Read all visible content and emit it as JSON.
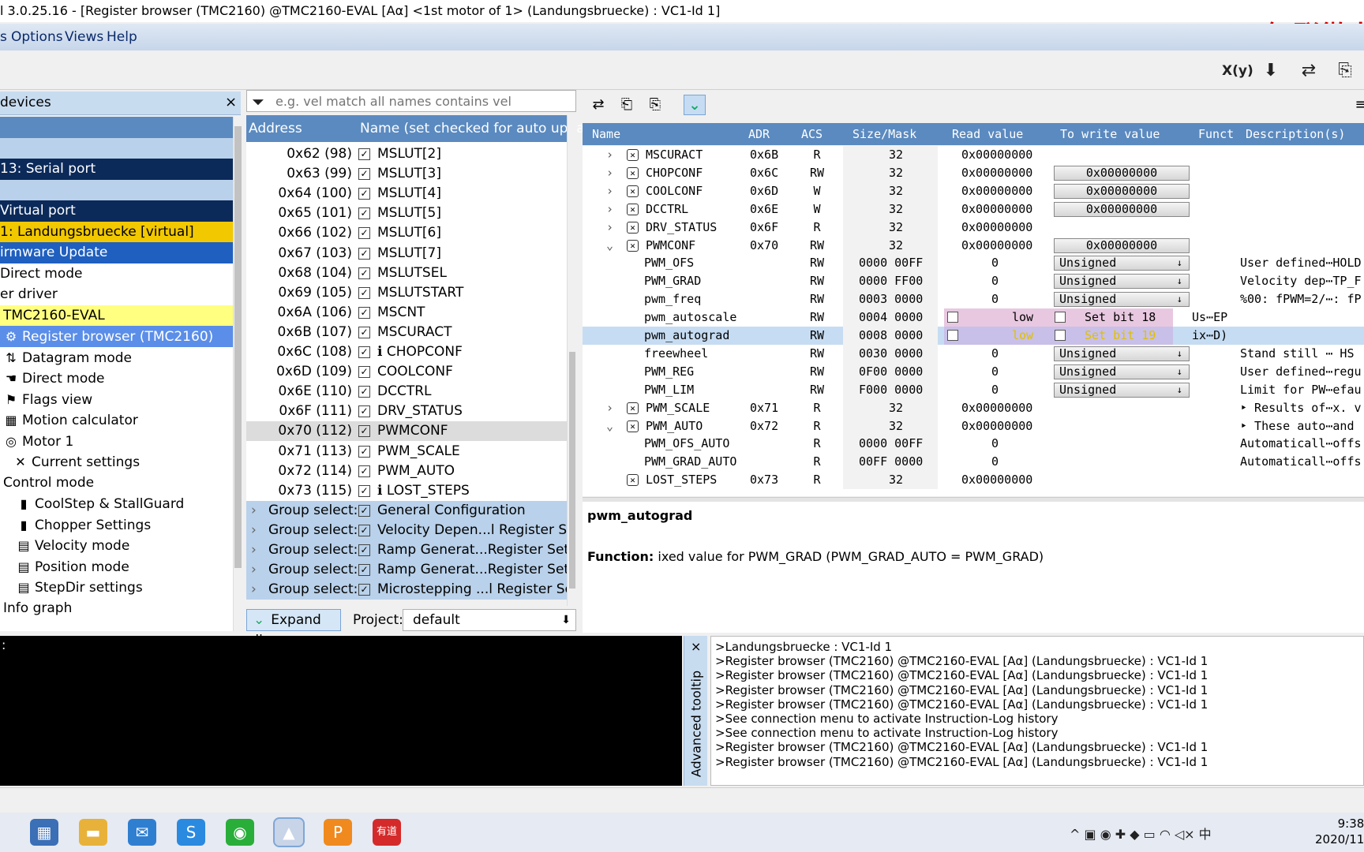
{
  "window": {
    "title": "l 3.0.25.16 - [Register browser (TMC2160) @TMC2160-EVAL [Aα] <1st motor of 1> (Landungsbruecke) : VC1-Id 1]",
    "brand_overlay": "智联微电"
  },
  "menu": {
    "items": [
      "s",
      "Options",
      "Views",
      "Help"
    ]
  },
  "toolbar": {
    "icons": [
      "x-y-icon",
      "download-icon",
      "swap-icon",
      "export-icon"
    ],
    "xy_label": "X(y)"
  },
  "left_panel": {
    "title": "devices",
    "close": "×",
    "tree": [
      {
        "label": "",
        "bg": "#5b8ac0",
        "color": "#fff",
        "icon": ""
      },
      {
        "label": "",
        "bg": "#b9d1ea",
        "color": "#000",
        "icon": ""
      },
      {
        "label": "13: Serial port",
        "bg": "#0b2a5a",
        "color": "#fff",
        "icon": ""
      },
      {
        "label": "",
        "bg": "#b9d1ea",
        "color": "#000",
        "icon": ""
      },
      {
        "label": " Virtual port",
        "bg": "#0b2a5a",
        "color": "#fff",
        "icon": ""
      },
      {
        "label": "1: Landungsbruecke [virtual]",
        "bg": "#f2c800",
        "color": "#000",
        "icon": ""
      },
      {
        "label": "irmware Update",
        "bg": "#1f5fbf",
        "color": "#fff",
        "icon": ""
      },
      {
        "label": "Direct mode",
        "bg": "#fff",
        "color": "#000",
        "icon": ""
      },
      {
        "label": "er driver",
        "bg": "#fff",
        "color": "#000",
        "icon": ""
      },
      {
        "label": "TMC2160-EVAL",
        "bg": "#ffff80",
        "color": "#000",
        "icon": ""
      },
      {
        "label": "Register browser (TMC2160)",
        "bg": "#5b8ee8",
        "color": "#fff",
        "icon": "⚙"
      },
      {
        "label": "Datagram mode",
        "bg": "#fff",
        "color": "#000",
        "icon": "⇅"
      },
      {
        "label": "Direct mode",
        "bg": "#fff",
        "color": "#000",
        "icon": "☚"
      },
      {
        "label": "Flags view",
        "bg": "#fff",
        "color": "#000",
        "icon": "⚑"
      },
      {
        "label": "Motion calculator",
        "bg": "#fff",
        "color": "#000",
        "icon": "▦"
      },
      {
        "label": "Motor 1",
        "bg": "#fff",
        "color": "#000",
        "icon": "◎"
      },
      {
        "label": "Current settings",
        "bg": "#fff",
        "color": "#000",
        "icon": "✕"
      },
      {
        "label": "Control mode",
        "bg": "#fff",
        "color": "#000",
        "icon": ""
      },
      {
        "label": "CoolStep & StallGuard",
        "bg": "#fff",
        "color": "#000",
        "icon": "▮"
      },
      {
        "label": "Chopper Settings",
        "bg": "#fff",
        "color": "#000",
        "icon": "▮"
      },
      {
        "label": "Velocity mode",
        "bg": "#fff",
        "color": "#000",
        "icon": "▤"
      },
      {
        "label": "Position mode",
        "bg": "#fff",
        "color": "#000",
        "icon": "▤"
      },
      {
        "label": "StepDir settings",
        "bg": "#fff",
        "color": "#000",
        "icon": "▤"
      },
      {
        "label": "Info graph",
        "bg": "#fff",
        "color": "#000",
        "icon": ""
      }
    ]
  },
  "middle_panel": {
    "filter_placeholder": "e.g. vel match all names contains vel",
    "col_address": "Address",
    "col_name": "Name (set checked for auto upda",
    "rows": [
      {
        "addr": "0x62 (98)",
        "name": "MSLUT[2]",
        "info": false
      },
      {
        "addr": "0x63 (99)",
        "name": "MSLUT[3]",
        "info": false
      },
      {
        "addr": "0x64 (100)",
        "name": "MSLUT[4]",
        "info": false
      },
      {
        "addr": "0x65 (101)",
        "name": "MSLUT[5]",
        "info": false
      },
      {
        "addr": "0x66 (102)",
        "name": "MSLUT[6]",
        "info": false
      },
      {
        "addr": "0x67 (103)",
        "name": "MSLUT[7]",
        "info": false
      },
      {
        "addr": "0x68 (104)",
        "name": "MSLUTSEL",
        "info": false
      },
      {
        "addr": "0x69 (105)",
        "name": "MSLUTSTART",
        "info": false
      },
      {
        "addr": "0x6A (106)",
        "name": "MSCNT",
        "info": false
      },
      {
        "addr": "0x6B (107)",
        "name": "MSCURACT",
        "info": false
      },
      {
        "addr": "0x6C (108)",
        "name": "CHOPCONF",
        "info": true
      },
      {
        "addr": "0x6D (109)",
        "name": "COOLCONF",
        "info": false
      },
      {
        "addr": "0x6E (110)",
        "name": "DCCTRL",
        "info": false
      },
      {
        "addr": "0x6F (111)",
        "name": "DRV_STATUS",
        "info": false
      },
      {
        "addr": "0x70 (112)",
        "name": "PWMCONF",
        "info": false,
        "selected": true
      },
      {
        "addr": "0x71 (113)",
        "name": "PWM_SCALE",
        "info": false
      },
      {
        "addr": "0x72 (114)",
        "name": "PWM_AUTO",
        "info": false
      },
      {
        "addr": "0x73 (115)",
        "name": "LOST_STEPS",
        "info": true
      }
    ],
    "groups": [
      {
        "label": "Group select:",
        "name": "General Configuration"
      },
      {
        "label": "Group select:",
        "name": "Velocity Depen...l Register Set"
      },
      {
        "label": "Group select:",
        "name": "Ramp Generat...Register Set"
      },
      {
        "label": "Group select:",
        "name": "Ramp Generat...Register Set"
      },
      {
        "label": "Group select:",
        "name": "Microstepping ...l Register Set"
      }
    ],
    "expand_all": "Expand all",
    "project_label": "Project:",
    "project_value": "default"
  },
  "register_table": {
    "headers": [
      "Name",
      "ADR",
      "ACS",
      "Size/Mask",
      "Read value",
      "To write value",
      "Funct",
      "Description(s)"
    ],
    "rows": [
      {
        "type": "reg",
        "exp": "›",
        "name": "MSCURACT",
        "adr": "0x6B",
        "acs": "R",
        "size": "32",
        "read": "0x00000000",
        "write": "",
        "func": "",
        "desc": ""
      },
      {
        "type": "reg",
        "exp": "›",
        "name": "CHOPCONF",
        "adr": "0x6C",
        "acs": "RW",
        "size": "32",
        "read": "0x00000000",
        "write": "0x00000000",
        "func": "",
        "desc": ""
      },
      {
        "type": "reg",
        "exp": "›",
        "name": "COOLCONF",
        "adr": "0x6D",
        "acs": "W",
        "size": "32",
        "read": "0x00000000",
        "write": "0x00000000",
        "func": "",
        "desc": ""
      },
      {
        "type": "reg",
        "exp": "›",
        "name": "DCCTRL",
        "adr": "0x6E",
        "acs": "W",
        "size": "32",
        "read": "0x00000000",
        "write": "0x00000000",
        "func": "",
        "desc": ""
      },
      {
        "type": "reg",
        "exp": "›",
        "name": "DRV_STATUS",
        "adr": "0x6F",
        "acs": "R",
        "size": "32",
        "read": "0x00000000",
        "write": "",
        "func": "",
        "desc": ""
      },
      {
        "type": "reg",
        "exp": "⌄",
        "name": "PWMCONF",
        "adr": "0x70",
        "acs": "RW",
        "size": "32",
        "read": "0x00000000",
        "write": "0x00000000",
        "func": "",
        "desc": ""
      },
      {
        "type": "field",
        "name": "PWM_OFS",
        "acs": "RW",
        "size": "0000 00FF",
        "read": "0",
        "dd": "Unsigned",
        "func": "",
        "desc": "User defined⋯HOLD"
      },
      {
        "type": "field",
        "name": "PWM_GRAD",
        "acs": "RW",
        "size": "0000 FF00",
        "read": "0",
        "dd": "Unsigned",
        "func": "",
        "desc": "Velocity dep⋯TP_F"
      },
      {
        "type": "field",
        "name": "pwm_freq",
        "acs": "RW",
        "size": "0003 0000",
        "read": "0",
        "dd": "Unsigned",
        "func": "",
        "desc": "%00: fPWM=2/⋯: fP"
      },
      {
        "type": "bit",
        "name": "pwm_autoscale",
        "acs": "RW",
        "size": "0004 0000",
        "read": "low",
        "bit": "Set bit 18",
        "func": "Us⋯EP",
        "desc": ""
      },
      {
        "type": "bit",
        "name": "pwm_autograd",
        "acs": "RW",
        "size": "0008 0000",
        "read": "low",
        "bit": "Set bit 19",
        "func": "ix⋯D)",
        "desc": "",
        "highlight": true
      },
      {
        "type": "field",
        "name": "freewheel",
        "acs": "RW",
        "size": "0030 0000",
        "read": "0",
        "dd": "Unsigned",
        "func": "",
        "desc": "Stand still ⋯ HS"
      },
      {
        "type": "field",
        "name": "PWM_REG",
        "acs": "RW",
        "size": "0F00 0000",
        "read": "0",
        "dd": "Unsigned",
        "func": "",
        "desc": "User defined⋯regu"
      },
      {
        "type": "field",
        "name": "PWM_LIM",
        "acs": "RW",
        "size": "F000 0000",
        "read": "0",
        "dd": "Unsigned",
        "func": "",
        "desc": "Limit for PW⋯efau"
      },
      {
        "type": "reg",
        "exp": "›",
        "name": "PWM_SCALE",
        "adr": "0x71",
        "acs": "R",
        "size": "32",
        "read": "0x00000000",
        "write": "",
        "func": "",
        "desc": "‣ Results of⋯x. v"
      },
      {
        "type": "reg",
        "exp": "⌄",
        "name": "PWM_AUTO",
        "adr": "0x72",
        "acs": "R",
        "size": "32",
        "read": "0x00000000",
        "write": "",
        "func": "",
        "desc": "‣ These auto⋯and"
      },
      {
        "type": "field2",
        "name": "PWM_OFS_AUTO",
        "acs": "R",
        "size": "0000 00FF",
        "read": "0",
        "func": "",
        "desc": "Automaticall⋯offs"
      },
      {
        "type": "field2",
        "name": "PWM_GRAD_AUTO",
        "acs": "R",
        "size": "00FF 0000",
        "read": "0",
        "func": "",
        "desc": "Automaticall⋯offs"
      },
      {
        "type": "reg",
        "exp": "",
        "name": "LOST_STEPS",
        "adr": "0x73",
        "acs": "R",
        "size": "32",
        "read": "0x00000000",
        "write": "",
        "func": "",
        "desc": ""
      }
    ]
  },
  "detail": {
    "title": "pwm_autograd",
    "function_label": "Function:",
    "function_text": " ixed value for PWM_GRAD (PWM_GRAD_AUTO = PWM_GRAD)"
  },
  "console": {
    "prompt": ":"
  },
  "advanced_tooltip": {
    "label": "Advanced tooltip",
    "close": "×"
  },
  "log": [
    ">Landungsbruecke : VC1-Id 1",
    ">Register browser (TMC2160) @TMC2160-EVAL [Aα] (Landungsbruecke) : VC1-Id 1",
    ">Register browser (TMC2160) @TMC2160-EVAL [Aα] (Landungsbruecke) : VC1-Id 1",
    ">Register browser (TMC2160) @TMC2160-EVAL [Aα] (Landungsbruecke) : VC1-Id 1",
    ">Register browser (TMC2160) @TMC2160-EVAL [Aα] (Landungsbruecke) : VC1-Id 1",
    ">See connection menu to activate Instruction-Log history",
    ">See connection menu to activate Instruction-Log history",
    ">Register browser (TMC2160) @TMC2160-EVAL [Aα] (Landungsbruecke) : VC1-Id 1",
    ">Register browser (TMC2160) @TMC2160-EVAL [Aα] (Landungsbruecke) : VC1-Id 1"
  ],
  "taskbar": {
    "apps": [
      {
        "name": "calculator-icon",
        "glyph": "▦",
        "color": "#3b6fb6"
      },
      {
        "name": "file-explorer-icon",
        "glyph": "▬",
        "color": "#e8b23a"
      },
      {
        "name": "mail-icon",
        "glyph": "✉",
        "color": "#2f7fd1"
      },
      {
        "name": "sogou-icon",
        "glyph": "S",
        "color": "#2a8ae0"
      },
      {
        "name": "wechat-icon",
        "glyph": "◉",
        "color": "#2aae3a"
      },
      {
        "name": "tmcl-ide-icon",
        "glyph": "▲",
        "color": "#c8d4e8"
      },
      {
        "name": "pdf-editor-icon",
        "glyph": "P",
        "color": "#f08a1e"
      },
      {
        "name": "youdao-icon",
        "glyph": "有道",
        "color": "#d42a2a"
      }
    ],
    "tray": "^ ▣ ◉ ✚ ◆ ▭ ◠ ◁× 中",
    "time": "9:38",
    "date": "2020/11"
  }
}
